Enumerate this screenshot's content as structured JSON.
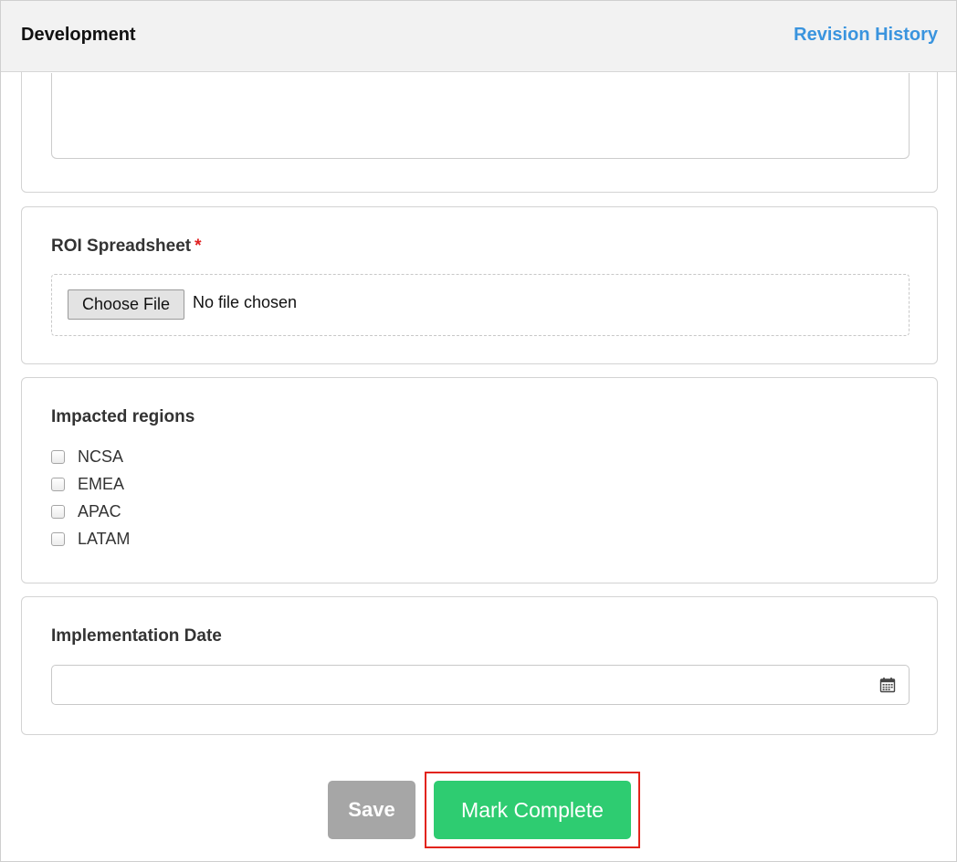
{
  "header": {
    "title": "Development",
    "revision_link": "Revision History"
  },
  "roi": {
    "label": "ROI Spreadsheet",
    "required_mark": "*",
    "choose_button": "Choose File",
    "file_status": "No file chosen"
  },
  "regions": {
    "label": "Impacted regions",
    "options": [
      {
        "label": "NCSA",
        "checked": false
      },
      {
        "label": "EMEA",
        "checked": false
      },
      {
        "label": "APAC",
        "checked": false
      },
      {
        "label": "LATAM",
        "checked": false
      }
    ]
  },
  "implementation": {
    "label": "Implementation Date",
    "value": ""
  },
  "actions": {
    "save_label": "Save",
    "complete_label": "Mark Complete"
  },
  "colors": {
    "accent_link": "#3a94de",
    "complete_green": "#2ecc71",
    "save_gray": "#a6a6a6",
    "highlight_red": "#e2231a",
    "required_red": "#e02020"
  },
  "icons": {
    "calendar": "calendar-icon",
    "checkbox": "checkbox-icon"
  }
}
